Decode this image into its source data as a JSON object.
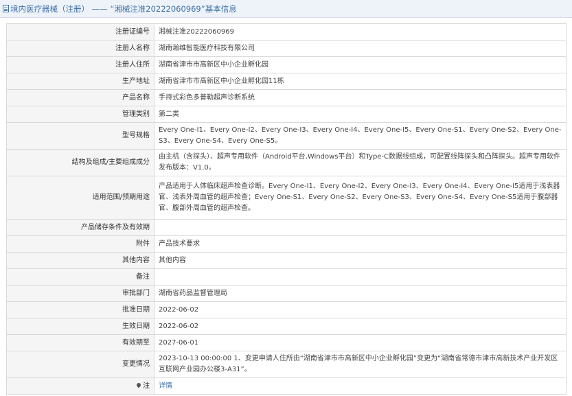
{
  "header": {
    "prefix": "境内医疗器械（注册）",
    "separator": " —— ",
    "reg_quote": "“湘械注准20222060969”",
    "suffix": "基本信息"
  },
  "rows": [
    {
      "label": "注册证编号",
      "value": "湘械注准20222060969"
    },
    {
      "label": "注册人名称",
      "value": "湖南瀚维智能医疗科技有限公司"
    },
    {
      "label": "注册人住所",
      "value": "湖南省津市市高新区中小企业孵化园"
    },
    {
      "label": "生产地址",
      "value": "湖南省津市市高新区中小企业孵化园11栋"
    },
    {
      "label": "产品名称",
      "value": "手持式彩色多普勒超声诊断系统"
    },
    {
      "label": "管理类别",
      "value": "第二类"
    },
    {
      "label": "型号规格",
      "value": "Every One-I1、Every One-I2、Every One-I3、Every One-I4、Every One-I5、Every One-S1、Every One-S2、Every One-S3、Every One-S4、Every One-S5。"
    },
    {
      "label": "结构及组成/主要组成成分",
      "value": "由主机（含探头）、超声专用软件（Android平台,Windows平台）和Type-C数据线组成，可配置线阵探头和凸阵探头。超声专用软件发布版本：V1.0。"
    },
    {
      "label": "适用范围/预期用途",
      "value": "产品适用于人体临床超声检查诊断。Every One-I1、Every One-I2、Every One-I3、Every One-I4、Every One-I5适用于浅表器官、浅表外周血管的超声检查；Every One-S1、Every One-S2、Every One-S3、Every One-S4、Every One-S5适用于腹部器官、腹部外周血管的超声检查。"
    },
    {
      "label": "产品储存条件及有效期",
      "value": ""
    },
    {
      "label": "附件",
      "value": "产品技术要求"
    },
    {
      "label": "其他内容",
      "value": "其他内容"
    },
    {
      "label": "备注",
      "value": ""
    },
    {
      "label": "审批部门",
      "value": "湖南省药品监督管理局"
    },
    {
      "label": "批准日期",
      "value": "2022-06-02"
    },
    {
      "label": "生效日期",
      "value": "2022-06-02"
    },
    {
      "label": "有效期至",
      "value": "2027-06-01"
    },
    {
      "label": "变更情况",
      "value": "2023-10-13 00:00:00 1、变更申请人住所由“湖南省津市市高新区中小企业孵化园”变更为“湖南省常德市津市高新技术产业开发区互联网产业园办公楼3-A31”。"
    }
  ],
  "footer_row": {
    "label": "注",
    "link_text": "详情"
  }
}
